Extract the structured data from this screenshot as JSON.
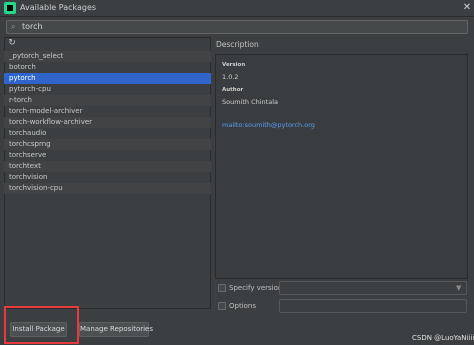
{
  "window": {
    "title": "Available Packages",
    "close_glyph": "✕"
  },
  "search": {
    "value": "torch",
    "icon": "search-icon"
  },
  "packages": [
    {
      "name": "_pytorch_select"
    },
    {
      "name": "botorch"
    },
    {
      "name": "pytorch",
      "selected": true
    },
    {
      "name": "pytorch-cpu"
    },
    {
      "name": "r-torch"
    },
    {
      "name": "torch-model-archiver"
    },
    {
      "name": "torch-workflow-archiver"
    },
    {
      "name": "torchaudio"
    },
    {
      "name": "torchcsprng"
    },
    {
      "name": "torchserve"
    },
    {
      "name": "torchtext"
    },
    {
      "name": "torchvision"
    },
    {
      "name": "torchvision-cpu"
    }
  ],
  "description": {
    "heading": "Description",
    "version_label": "Version",
    "version": "1.0.2",
    "author_label": "Author",
    "author": "Soumith Chintala",
    "email": "mailto:soumith@pytorch.org"
  },
  "options": {
    "specify_version_label": "Specify version",
    "specify_version_checked": false,
    "options_label": "Options",
    "options_checked": false
  },
  "buttons": {
    "install": "Install Package",
    "manage": "Manage Repositories"
  },
  "watermark": "CSDN @LuoYaNiiii",
  "colors": {
    "background": "#3c3f41",
    "selection": "#2f65ca",
    "link": "#589df6",
    "highlight": "#e83a3a"
  }
}
